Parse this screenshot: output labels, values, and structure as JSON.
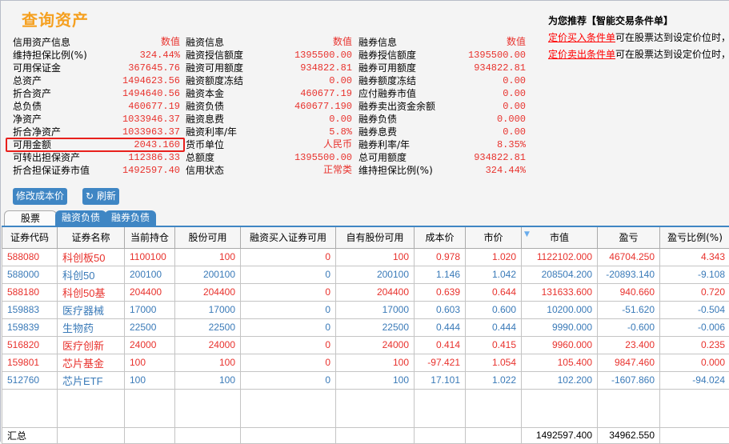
{
  "title": "查询资产",
  "credit": [
    [
      "信用资产信息",
      "数值"
    ],
    [
      "维持担保比例(%)",
      "324.44%"
    ],
    [
      "可用保证金",
      "367645.76"
    ],
    [
      "总资产",
      "1494623.56"
    ],
    [
      "折合资产",
      "1494640.56"
    ],
    [
      "总负债",
      "460677.19"
    ],
    [
      "净资产",
      "1033946.37"
    ],
    [
      "折合净资产",
      "1033963.37"
    ],
    [
      "可用金额",
      "2043.160"
    ],
    [
      "可转出担保资产",
      "112386.33"
    ],
    [
      "折合担保证券市值",
      "1492597.40"
    ]
  ],
  "financing": [
    [
      "融资信息",
      "数值"
    ],
    [
      "融资授信额度",
      "1395500.00"
    ],
    [
      "融资可用额度",
      "934822.81"
    ],
    [
      "融资额度冻结",
      "0.00"
    ],
    [
      "融资本金",
      "460677.19"
    ],
    [
      "融资负债",
      "460677.190"
    ],
    [
      "融资息费",
      "0.00"
    ],
    [
      "融资利率/年",
      "5.8%"
    ],
    [
      "货币单位",
      "人民币"
    ],
    [
      "总额度",
      "1395500.00"
    ],
    [
      "信用状态",
      "正常类"
    ]
  ],
  "securities_lending": [
    [
      "融券信息",
      "数值"
    ],
    [
      "融券授信额度",
      "1395500.00"
    ],
    [
      "融券可用额度",
      "934822.81"
    ],
    [
      "融券额度冻结",
      "0.00"
    ],
    [
      "应付融券市值",
      "0.00"
    ],
    [
      "融券卖出资金余额",
      "0.00"
    ],
    [
      "融券负债",
      "0.000"
    ],
    [
      "融券息费",
      "0.00"
    ],
    [
      "融券利率/年",
      "8.35%"
    ],
    [
      "总可用额度",
      "934822.81"
    ],
    [
      "维持担保比例(%)",
      "324.44%"
    ]
  ],
  "recommend": {
    "title": "为您推荐【智能交易条件单】",
    "items": [
      {
        "link": "定价买入条件单",
        "text": "可在股票达到设定价位时，"
      },
      {
        "link": "定价卖出条件单",
        "text": "可在股票达到设定价位时，"
      }
    ]
  },
  "buttons": {
    "modify_cost": "修改成本价",
    "refresh": "刷新"
  },
  "tabs": [
    "股票",
    "融资负债",
    "融券负债"
  ],
  "table": {
    "headers": [
      "证券代码",
      "证券名称",
      "当前持仓",
      "股份可用",
      "融资买入证券可用",
      "自有股份可用",
      "成本价",
      "市价",
      "市值",
      "盈亏",
      "盈亏比例(%)"
    ],
    "rows": [
      [
        "588080",
        "科创板50",
        "1100100",
        "100",
        "0",
        "100",
        "0.978",
        "1.020",
        "1122102.000",
        "46704.250",
        "4.343"
      ],
      [
        "588000",
        "科创50",
        "200100",
        "200100",
        "0",
        "200100",
        "1.146",
        "1.042",
        "208504.200",
        "-20893.140",
        "-9.108"
      ],
      [
        "588180",
        "科创50基",
        "204400",
        "204400",
        "0",
        "204400",
        "0.639",
        "0.644",
        "131633.600",
        "940.660",
        "0.720"
      ],
      [
        "159883",
        "医疗器械",
        "17000",
        "17000",
        "0",
        "17000",
        "0.603",
        "0.600",
        "10200.000",
        "-51.620",
        "-0.504"
      ],
      [
        "159839",
        "生物药",
        "22500",
        "22500",
        "0",
        "22500",
        "0.444",
        "0.444",
        "9990.000",
        "-0.600",
        "-0.006"
      ],
      [
        "516820",
        "医疗创新",
        "24000",
        "24000",
        "0",
        "24000",
        "0.414",
        "0.415",
        "9960.000",
        "23.400",
        "0.235"
      ],
      [
        "159801",
        "芯片基金",
        "100",
        "100",
        "0",
        "100",
        "-97.421",
        "1.054",
        "105.400",
        "9847.460",
        "0.000"
      ],
      [
        "512760",
        "芯片ETF",
        "100",
        "100",
        "0",
        "100",
        "17.101",
        "1.022",
        "102.200",
        "-1607.860",
        "-94.024"
      ]
    ],
    "row_trend": [
      "up",
      "dn",
      "up",
      "dn",
      "dn",
      "up",
      "up",
      "dn"
    ],
    "summary": {
      "label": "汇总",
      "market_value": "1492597.400",
      "profit": "34962.550"
    }
  }
}
